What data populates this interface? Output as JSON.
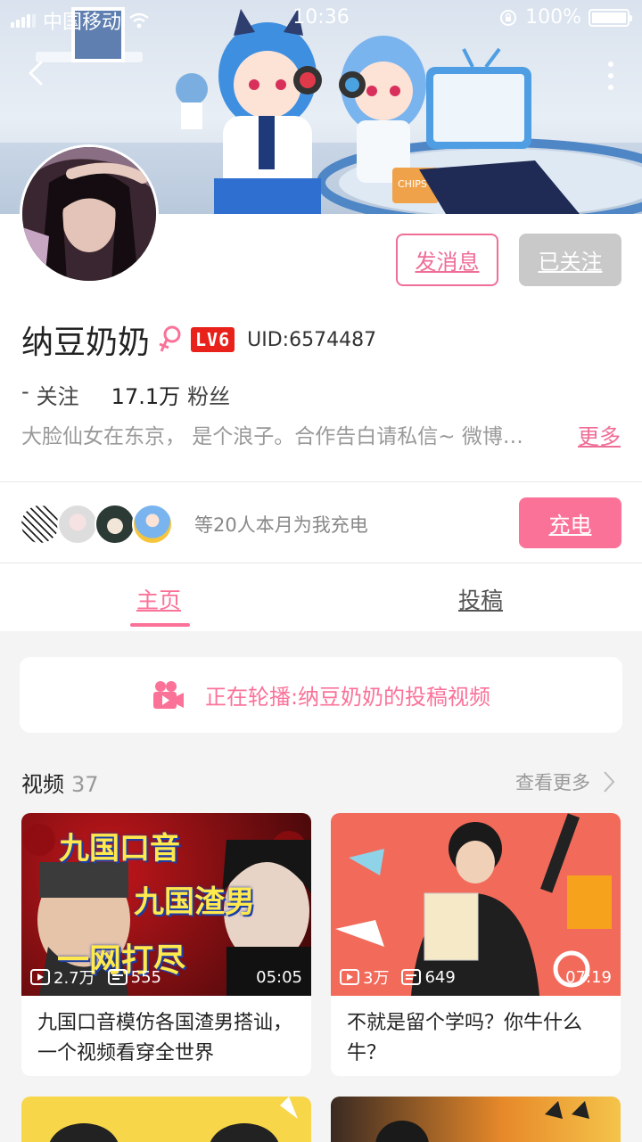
{
  "status_bar": {
    "carrier": "中国移动",
    "time": "10:36",
    "battery": "100%"
  },
  "profile": {
    "name": "纳豆奶奶",
    "level": "LV6",
    "uid": "UID:6574487",
    "following": "-",
    "following_label": "关注",
    "fans": "17.1万",
    "fans_label": "粉丝",
    "bio": "大脸仙女在东京， 是个浪子。合作告白请私信~ 微博…",
    "more_label": "更多",
    "message_button": "发消息",
    "follow_button": "已关注"
  },
  "charge": {
    "text": "等20人本月为我充电",
    "button": "充电"
  },
  "tabs": [
    {
      "label": "主页"
    },
    {
      "label": "投稿"
    }
  ],
  "playing": {
    "text": "正在轮播:纳豆奶奶的投稿视频"
  },
  "videos_section": {
    "title": "视频",
    "count": "37",
    "see_more": "查看更多"
  },
  "videos": [
    {
      "title": "九国口音模仿各国渣男搭讪，一个视频看穿全世界",
      "views": "2.7万",
      "comments": "555",
      "duration": "05:05",
      "thumb_text": [
        "九国口音",
        "九国渣男",
        "一网打尽"
      ]
    },
    {
      "title": "不就是留个学吗？你牛什么牛？",
      "views": "3万",
      "comments": "649",
      "duration": "07:19"
    }
  ],
  "colors": {
    "accent": "#fb7299",
    "level_badge": "#e8221b",
    "followed_button": "#c9c9c9"
  }
}
